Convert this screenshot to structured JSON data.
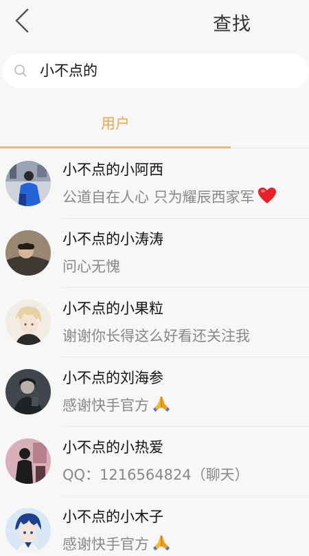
{
  "header": {
    "title": "查找",
    "back_icon": "chevron-left-icon"
  },
  "search": {
    "icon": "search-icon",
    "value": "小不点的"
  },
  "tabs": [
    {
      "label": "用户",
      "active": true
    }
  ],
  "colors": {
    "accent": "#f0a64e",
    "underline": "#f4b77a",
    "text_primary": "#111111",
    "text_secondary": "#888888",
    "background": "#f7f7f7"
  },
  "users": [
    {
      "name": "小不点的小阿西",
      "bio": "公道自在人心 只为耀辰西家军",
      "emoji": "red-heart-icon",
      "avatar": "avatar-blue-jacket"
    },
    {
      "name": "小不点的小涛涛",
      "bio": "问心无愧",
      "emoji": "",
      "avatar": "avatar-sleeping-boy"
    },
    {
      "name": "小不点的小果粒",
      "bio": "谢谢你长得这么好看还关注我",
      "emoji": "",
      "avatar": "avatar-anime-blond"
    },
    {
      "name": "小不点的刘海参",
      "bio": "感谢快手官方",
      "emoji": "praying-hands-icon",
      "avatar": "avatar-dark-photo"
    },
    {
      "name": "小不点的小热爱",
      "bio": "QQ：1216564824（聊天）",
      "emoji": "",
      "avatar": "avatar-pink-room"
    },
    {
      "name": "小不点的小木子",
      "bio": "感谢快手官方",
      "emoji": "praying-hands-icon",
      "avatar": "avatar-anime-blue"
    }
  ]
}
